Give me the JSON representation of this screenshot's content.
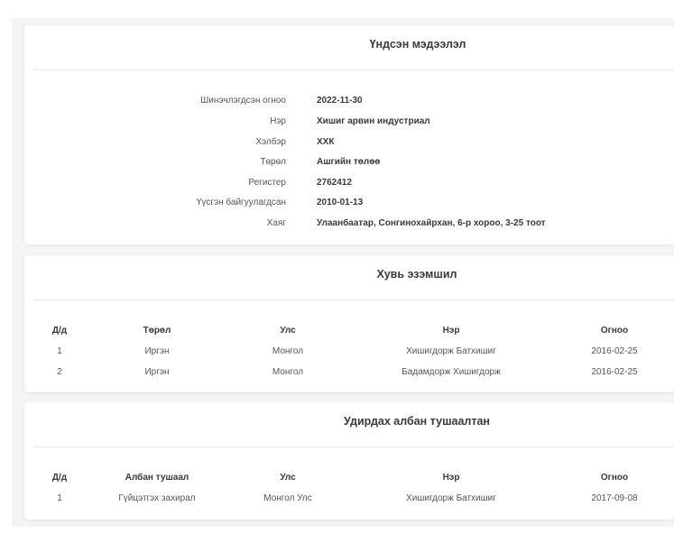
{
  "info": {
    "title": "Үндсэн мэдээлэл",
    "rows": [
      {
        "label": "Шинэчлэгдсэн огноо",
        "value": "2022-11-30"
      },
      {
        "label": "Нэр",
        "value": "Хишиг арвин индустриал"
      },
      {
        "label": "Хэлбэр",
        "value": "ХХК"
      },
      {
        "label": "Төрөл",
        "value": "Ашгийн төлөө"
      },
      {
        "label": "Регистер",
        "value": "2762412"
      },
      {
        "label": "Үүсгэн байгуулагдсан",
        "value": "2010-01-13"
      },
      {
        "label": "Хаяг",
        "value": "Улаанбаатар, Сонгинохайрхан, 6-р хороо, 3-25 тоот"
      }
    ]
  },
  "owners": {
    "title": "Хувь эзэмшил",
    "headers": [
      "Д/д",
      "Төрөл",
      "Улс",
      "Нэр",
      "Огноо"
    ],
    "rows": [
      [
        "1",
        "Иргэн",
        "Монгол",
        "Хишигдорж Батхишиг",
        "2016-02-25"
      ],
      [
        "2",
        "Иргэн",
        "Монгол",
        "Бадамдорж Хишигдорж",
        "2016-02-25"
      ]
    ]
  },
  "managers": {
    "title": "Удирдах албан тушаалтан",
    "headers": [
      "Д/д",
      "Албан тушаал",
      "Улс",
      "Нэр",
      "Огноо"
    ],
    "rows": [
      [
        "1",
        "Гүйцэтгэх захирал",
        "Монгол Улс",
        "Хишигдорж Батхишиг",
        "2017-09-08"
      ]
    ]
  }
}
